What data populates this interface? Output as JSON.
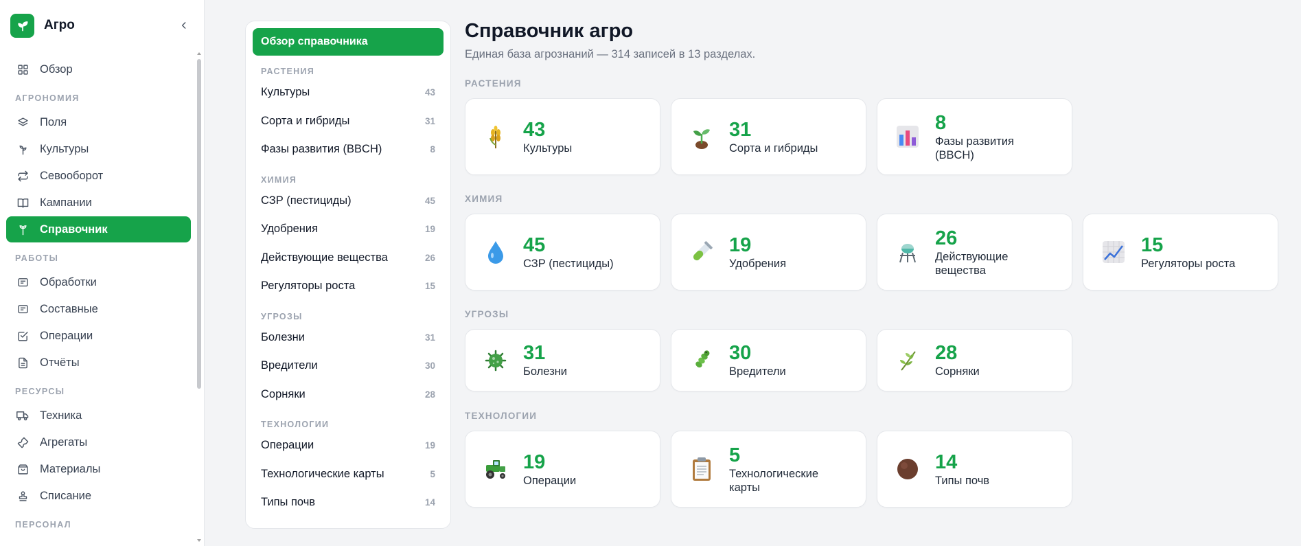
{
  "app": {
    "title": "Агро"
  },
  "sidebar": {
    "top_item": {
      "label": "Обзор",
      "icon": "grid-icon"
    },
    "sections": [
      {
        "label": "АГРОНОМИЯ",
        "items": [
          {
            "label": "Поля",
            "icon": "layers-icon",
            "active": false
          },
          {
            "label": "Культуры",
            "icon": "sprout-icon",
            "active": false
          },
          {
            "label": "Севооборот",
            "icon": "repeat-icon",
            "active": false
          },
          {
            "label": "Кампании",
            "icon": "book-icon",
            "active": false
          },
          {
            "label": "Справочник",
            "icon": "plant-icon",
            "active": true
          }
        ]
      },
      {
        "label": "РАБОТЫ",
        "items": [
          {
            "label": "Обработки",
            "icon": "message-square-icon",
            "active": false
          },
          {
            "label": "Составные",
            "icon": "message-square-icon",
            "active": false
          },
          {
            "label": "Операции",
            "icon": "check-square-icon",
            "active": false
          },
          {
            "label": "Отчёты",
            "icon": "file-icon",
            "active": false
          }
        ]
      },
      {
        "label": "РЕСУРСЫ",
        "items": [
          {
            "label": "Техника",
            "icon": "truck-icon",
            "active": false
          },
          {
            "label": "Агрегаты",
            "icon": "wrench-icon",
            "active": false
          },
          {
            "label": "Материалы",
            "icon": "package-icon",
            "active": false
          },
          {
            "label": "Списание",
            "icon": "stamp-icon",
            "active": false
          }
        ]
      },
      {
        "label": "ПЕРСОНАЛ",
        "items": []
      }
    ]
  },
  "directory": {
    "overview_label": "Обзор справочника",
    "sections": [
      {
        "label": "РАСТЕНИЯ",
        "items": [
          {
            "label": "Культуры",
            "count": "43"
          },
          {
            "label": "Сорта и гибриды",
            "count": "31"
          },
          {
            "label": "Фазы развития (BBCH)",
            "count": "8"
          }
        ]
      },
      {
        "label": "ХИМИЯ",
        "items": [
          {
            "label": "СЗР (пестициды)",
            "count": "45"
          },
          {
            "label": "Удобрения",
            "count": "19"
          },
          {
            "label": "Действующие вещества",
            "count": "26"
          },
          {
            "label": "Регуляторы роста",
            "count": "15"
          }
        ]
      },
      {
        "label": "УГРОЗЫ",
        "items": [
          {
            "label": "Болезни",
            "count": "31"
          },
          {
            "label": "Вредители",
            "count": "30"
          },
          {
            "label": "Сорняки",
            "count": "28"
          }
        ]
      },
      {
        "label": "ТЕХНОЛОГИИ",
        "items": [
          {
            "label": "Операции",
            "count": "19"
          },
          {
            "label": "Технологические карты",
            "count": "5"
          },
          {
            "label": "Типы почв",
            "count": "14"
          }
        ]
      }
    ]
  },
  "main": {
    "title": "Справочник агро",
    "subtitle": "Единая база агрознаний — 314 записей в 13 разделах.",
    "sections": [
      {
        "label": "РАСТЕНИЯ",
        "cards": [
          {
            "value": "43",
            "label": "Культуры",
            "icon": "wheat-icon"
          },
          {
            "value": "31",
            "label": "Сорта и гибриды",
            "icon": "seedling-icon"
          },
          {
            "value": "8",
            "label": "Фазы развития (BBCH)",
            "icon": "bar-chart-icon"
          }
        ]
      },
      {
        "label": "ХИМИЯ",
        "cards": [
          {
            "value": "45",
            "label": "СЗР (пестициды)",
            "icon": "droplet-icon"
          },
          {
            "value": "19",
            "label": "Удобрения",
            "icon": "test-tube-icon"
          },
          {
            "value": "26",
            "label": "Действующие вещества",
            "icon": "alembic-icon"
          },
          {
            "value": "15",
            "label": "Регуляторы роста",
            "icon": "trend-chart-icon"
          }
        ]
      },
      {
        "label": "УГРОЗЫ",
        "cards": [
          {
            "value": "31",
            "label": "Болезни",
            "icon": "microbe-icon"
          },
          {
            "value": "30",
            "label": "Вредители",
            "icon": "bug-icon"
          },
          {
            "value": "28",
            "label": "Сорняки",
            "icon": "herb-icon"
          }
        ]
      },
      {
        "label": "ТЕХНОЛОГИИ",
        "cards": [
          {
            "value": "19",
            "label": "Операции",
            "icon": "tractor-icon"
          },
          {
            "value": "5",
            "label": "Технологические карты",
            "icon": "clipboard-icon"
          },
          {
            "value": "14",
            "label": "Типы почв",
            "icon": "soil-icon"
          }
        ]
      }
    ]
  },
  "colors": {
    "accent": "#16a34a",
    "muted": "#9ca3af",
    "background": "#f3f4f6"
  }
}
